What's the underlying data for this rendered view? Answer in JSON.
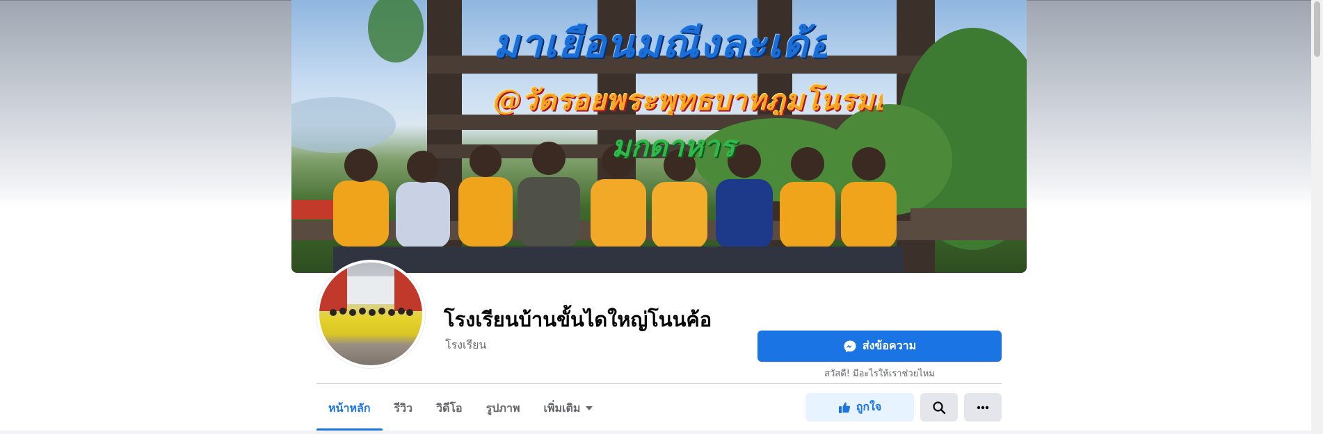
{
  "cover": {
    "sign_line_1": "มาเยือนมณีงละเด้อ",
    "sign_line_2": "@วัดรอยพระพุทธบาทภูมโนรมย์",
    "sign_line_3": "มุกดาหาร"
  },
  "profile": {
    "name": "โรงเรียนบ้านขั้นไดใหญ่โนนค้อ",
    "category": "โรงเรียน"
  },
  "actions": {
    "send_message_label": "ส่งข้อความ",
    "greeting": "สวัสดี! มีอะไรให้เราช่วยไหม",
    "like_label": "ถูกใจ"
  },
  "tabs": [
    {
      "label": "หน้าหลัก",
      "active": true
    },
    {
      "label": "รีวิว",
      "active": false
    },
    {
      "label": "วิดีโอ",
      "active": false
    },
    {
      "label": "รูปภาพ",
      "active": false
    },
    {
      "label": "เพิ่มเติม",
      "active": false,
      "dropdown": true
    }
  ],
  "icons": {
    "messenger": "messenger-icon",
    "like": "thumbs-up-icon",
    "search": "search-icon",
    "more": "more-horizontal-icon",
    "dropdown": "caret-down-icon"
  },
  "colors": {
    "accent": "#1b74e4",
    "accent_light": "#e7f3ff",
    "secondary_button": "#e4e6eb",
    "text_secondary": "#65676b"
  }
}
